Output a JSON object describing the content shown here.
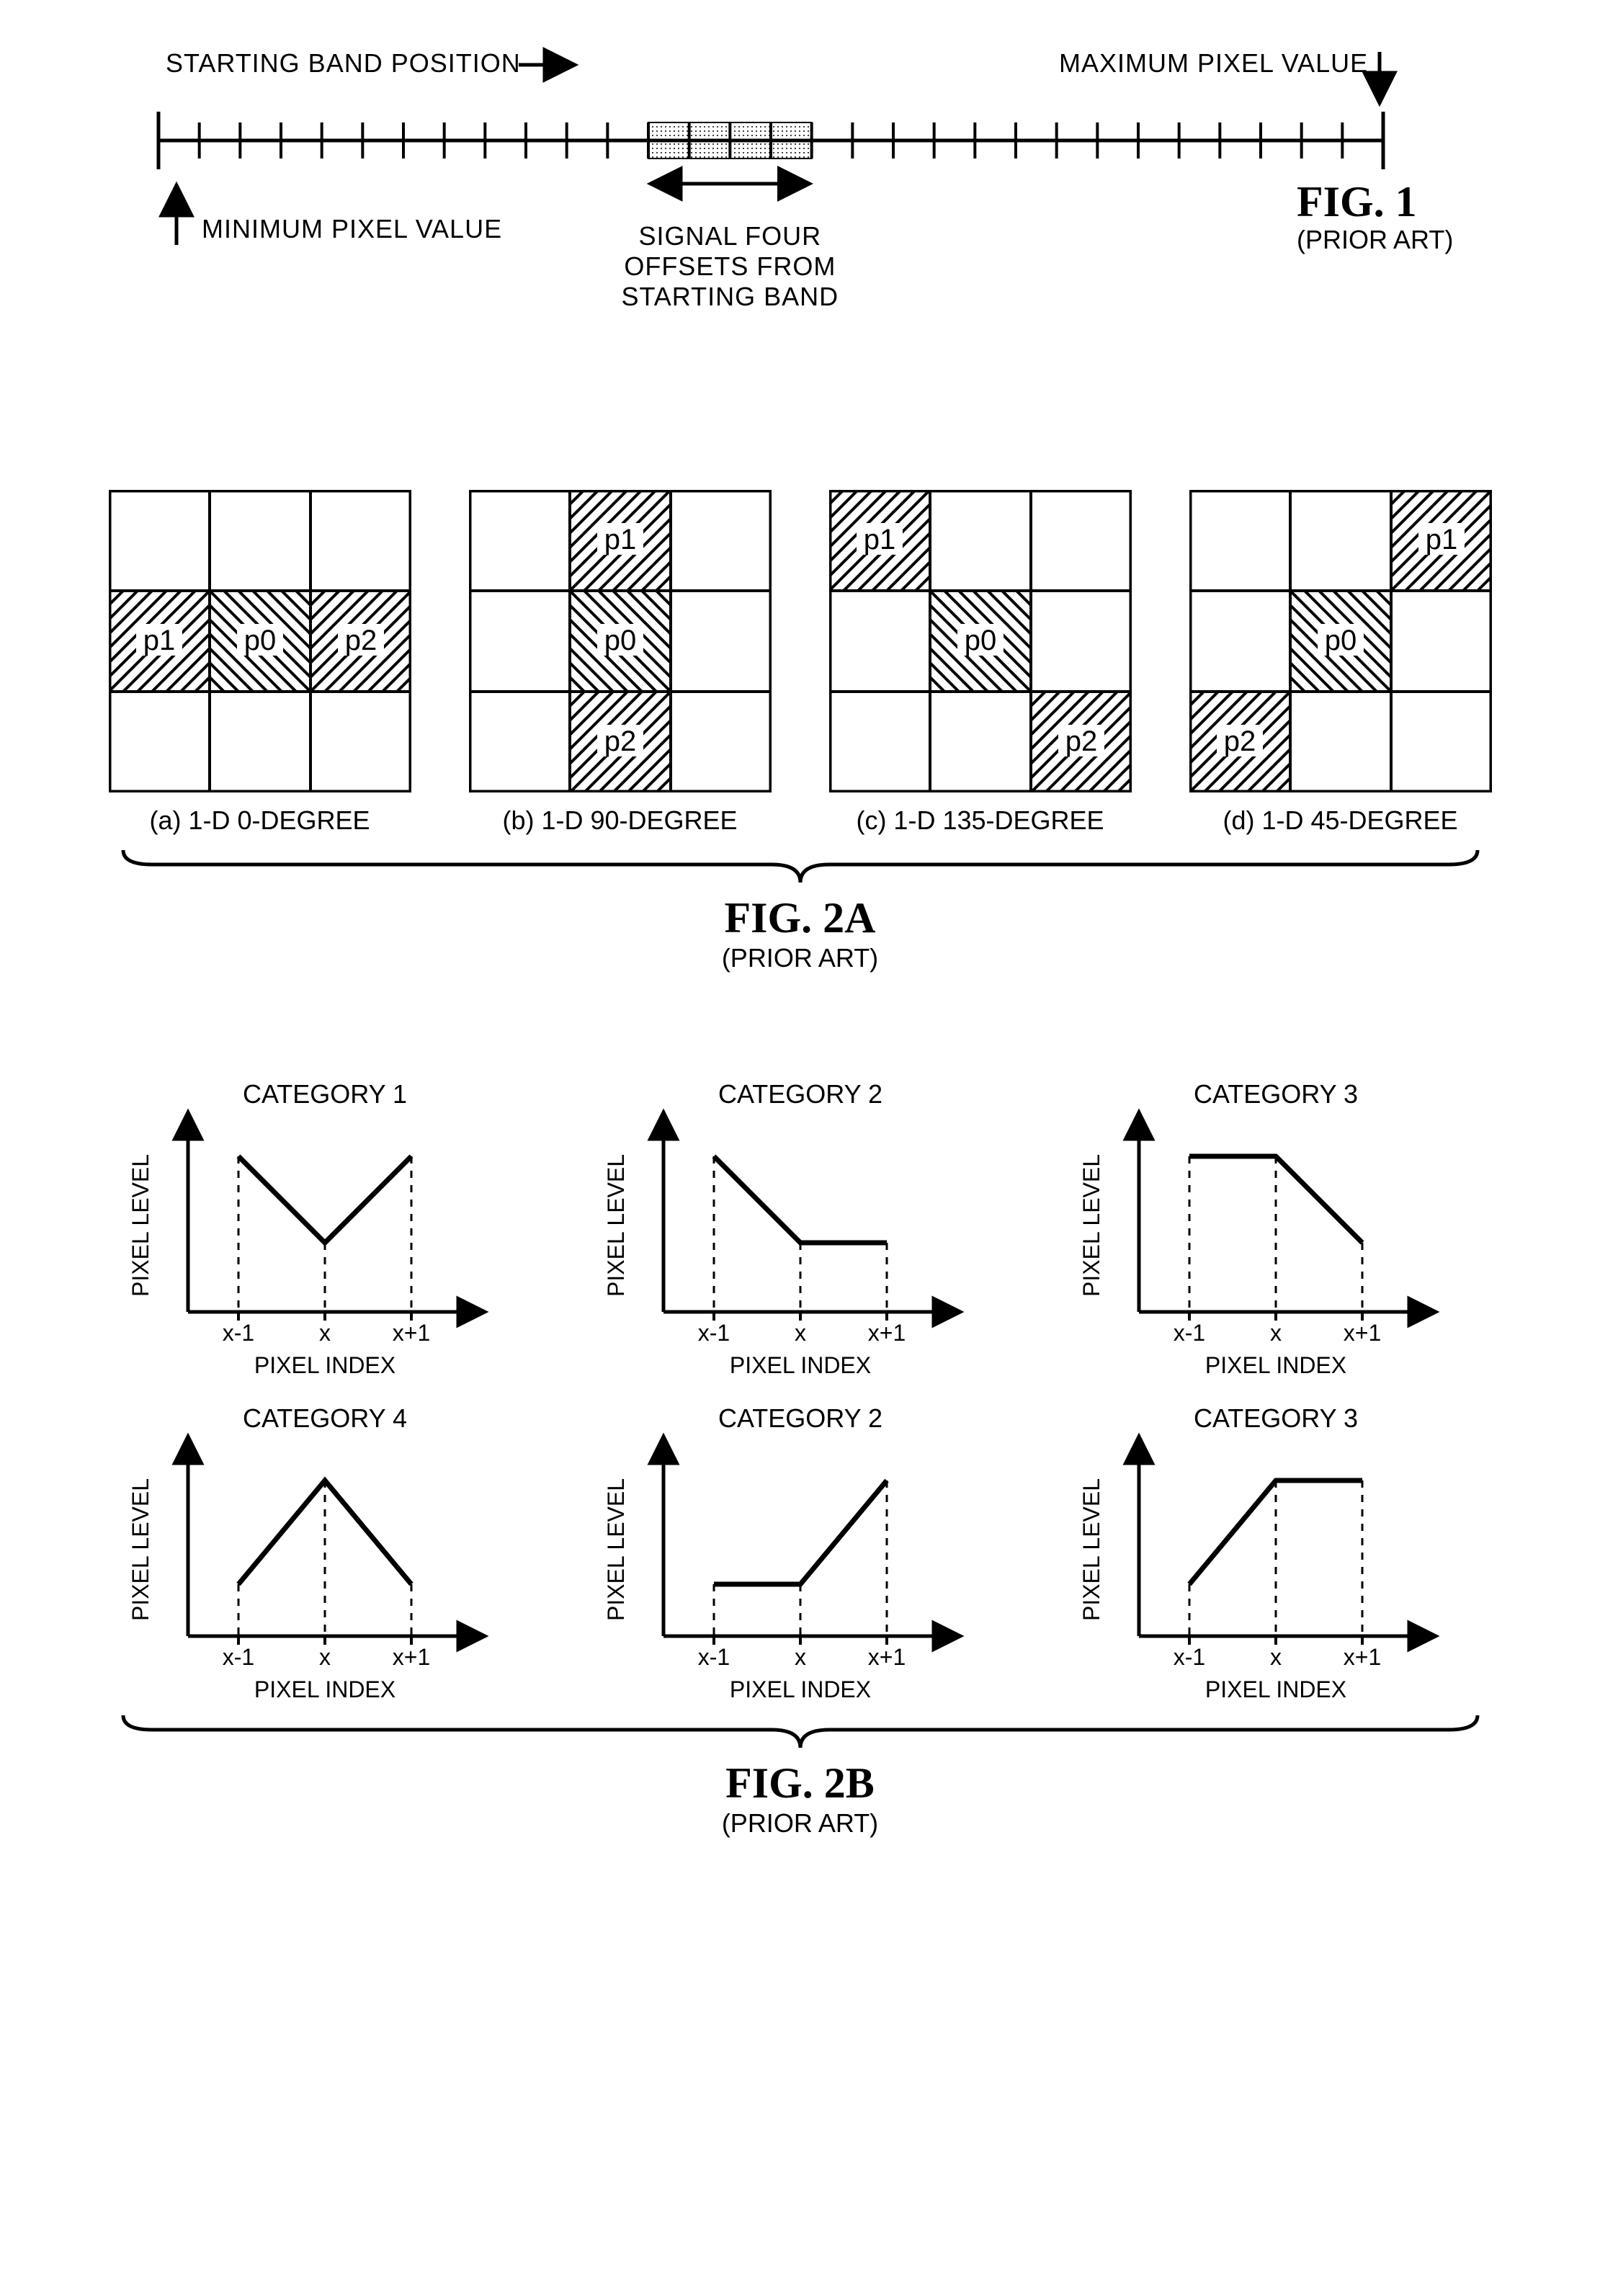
{
  "fig1": {
    "title": "FIG. 1",
    "sub": "(PRIOR ART)",
    "labels": {
      "starting_band": "STARTING BAND POSITION",
      "max_px": "MAXIMUM PIXEL VALUE",
      "min_px": "MINIMUM PIXEL VALUE",
      "signal": "SIGNAL FOUR OFFSETS FROM STARTING BAND"
    },
    "band": {
      "total_ticks": 30,
      "start_index": 12,
      "count": 4
    }
  },
  "fig2a": {
    "title": "FIG. 2A",
    "sub": "(PRIOR ART)",
    "cells": [
      "p0",
      "p1",
      "p2"
    ],
    "items": [
      {
        "caption": "(a) 1-D 0-DEGREE",
        "p1": 3,
        "p0": 4,
        "p2": 5,
        "hatch_p1": "f",
        "hatch_p0": "b",
        "hatch_p2": "f"
      },
      {
        "caption": "(b) 1-D 90-DEGREE",
        "p1": 1,
        "p0": 4,
        "p2": 7,
        "hatch_p1": "f",
        "hatch_p0": "b",
        "hatch_p2": "f"
      },
      {
        "caption": "(c) 1-D 135-DEGREE",
        "p1": 0,
        "p0": 4,
        "p2": 8,
        "hatch_p1": "f",
        "hatch_p0": "b",
        "hatch_p2": "f"
      },
      {
        "caption": "(d) 1-D 45-DEGREE",
        "p1": 2,
        "p0": 4,
        "p2": 6,
        "hatch_p1": "f",
        "hatch_p0": "b",
        "hatch_p2": "f"
      }
    ]
  },
  "fig2b": {
    "title": "FIG. 2B",
    "sub": "(PRIOR ART)",
    "ylabel": "PIXEL LEVEL",
    "xlabel": "PIXEL INDEX",
    "xticks": [
      "x-1",
      "x",
      "x+1"
    ],
    "items": [
      {
        "title": "CATEGORY 1",
        "ys": [
          90,
          40,
          90
        ]
      },
      {
        "title": "CATEGORY 2",
        "ys": [
          90,
          40,
          40
        ]
      },
      {
        "title": "CATEGORY 3",
        "ys": [
          90,
          90,
          40
        ]
      },
      {
        "title": "CATEGORY 4",
        "ys": [
          30,
          90,
          30
        ]
      },
      {
        "title": "CATEGORY 2",
        "ys": [
          30,
          30,
          90
        ]
      },
      {
        "title": "CATEGORY 3",
        "ys": [
          30,
          90,
          90
        ]
      }
    ]
  },
  "chart_data": [
    {
      "type": "line",
      "title": "CATEGORY 1",
      "xlabel": "PIXEL INDEX",
      "ylabel": "PIXEL LEVEL",
      "categories": [
        "x-1",
        "x",
        "x+1"
      ],
      "values": [
        "high",
        "low",
        "high"
      ],
      "note": "local minimum (V shape)"
    },
    {
      "type": "line",
      "title": "CATEGORY 2",
      "xlabel": "PIXEL INDEX",
      "ylabel": "PIXEL LEVEL",
      "categories": [
        "x-1",
        "x",
        "x+1"
      ],
      "values": [
        "high",
        "low",
        "low"
      ],
      "note": "edge – drop then flat"
    },
    {
      "type": "line",
      "title": "CATEGORY 3",
      "xlabel": "PIXEL INDEX",
      "ylabel": "PIXEL LEVEL",
      "categories": [
        "x-1",
        "x",
        "x+1"
      ],
      "values": [
        "high",
        "high",
        "low"
      ],
      "note": "edge – flat then drop"
    },
    {
      "type": "line",
      "title": "CATEGORY 4",
      "xlabel": "PIXEL INDEX",
      "ylabel": "PIXEL LEVEL",
      "categories": [
        "x-1",
        "x",
        "x+1"
      ],
      "values": [
        "low",
        "high",
        "low"
      ],
      "note": "local maximum (inverted V)"
    },
    {
      "type": "line",
      "title": "CATEGORY 2",
      "xlabel": "PIXEL INDEX",
      "ylabel": "PIXEL LEVEL",
      "categories": [
        "x-1",
        "x",
        "x+1"
      ],
      "values": [
        "low",
        "low",
        "high"
      ],
      "note": "edge – flat then rise"
    },
    {
      "type": "line",
      "title": "CATEGORY 3",
      "xlabel": "PIXEL INDEX",
      "ylabel": "PIXEL LEVEL",
      "categories": [
        "x-1",
        "x",
        "x+1"
      ],
      "values": [
        "low",
        "high",
        "high"
      ],
      "note": "edge – rise then flat"
    }
  ]
}
